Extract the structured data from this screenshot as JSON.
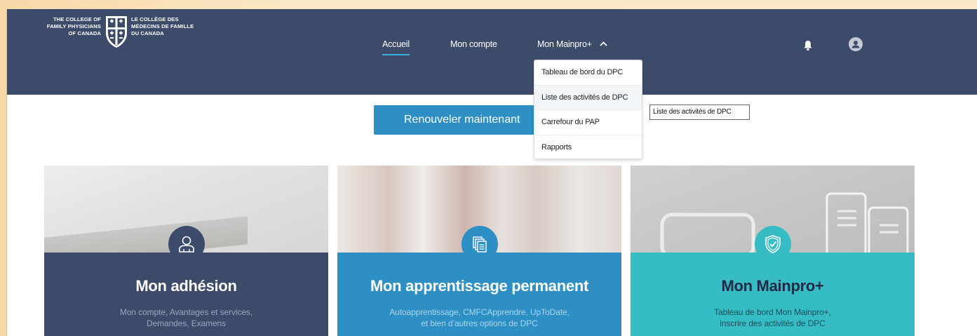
{
  "logo": {
    "left_lines": [
      "THE COLLEGE OF",
      "FAMILY PHYSICIANS",
      "OF CANADA"
    ],
    "right_lines": [
      "LE COLLÈGE DES",
      "MÉDECINS DE FAMILLE",
      "DU CANADA"
    ]
  },
  "nav": {
    "items": [
      {
        "label": "Accueil"
      },
      {
        "label": "Mon compte"
      },
      {
        "label": "Mon Mainpro+"
      }
    ]
  },
  "icons": {
    "bell": "bell-icon",
    "avatar": "user-avatar-icon",
    "chevron": "chevron-up-icon"
  },
  "renew_button": {
    "label": "Renouveler maintenant"
  },
  "dropdown": {
    "items": [
      {
        "label": "Tableau de bord du DPC"
      },
      {
        "label": "Liste des activités de DPC"
      },
      {
        "label": "Carrefour du PAP"
      },
      {
        "label": "Rapports"
      }
    ]
  },
  "tooltip": {
    "text": "Liste des activités de DPC"
  },
  "cards": [
    {
      "title": "Mon adhésion",
      "desc_lines": [
        "Mon compte, Avantages et services,",
        "Demandes, Examens"
      ],
      "icon": "user-icon",
      "color": "#3d4b6b"
    },
    {
      "title": "Mon apprentissage permanent",
      "desc_lines": [
        "Autoapprentissage, CMFCApprendre, UpToDate,",
        "et bien d’autres options de DPC"
      ],
      "icon": "documents-icon",
      "color": "#2d8fc4"
    },
    {
      "title": "Mon Mainpro+",
      "desc_lines": [
        "Tableau de bord Mon Mainpro+,",
        "inscrire des activités de DPC"
      ],
      "icon": "shield-check-icon",
      "color": "#36bcc4"
    }
  ],
  "colors": {
    "header": "#3d4b6b",
    "accent": "#2d8fc4",
    "teal": "#36bcc4"
  }
}
